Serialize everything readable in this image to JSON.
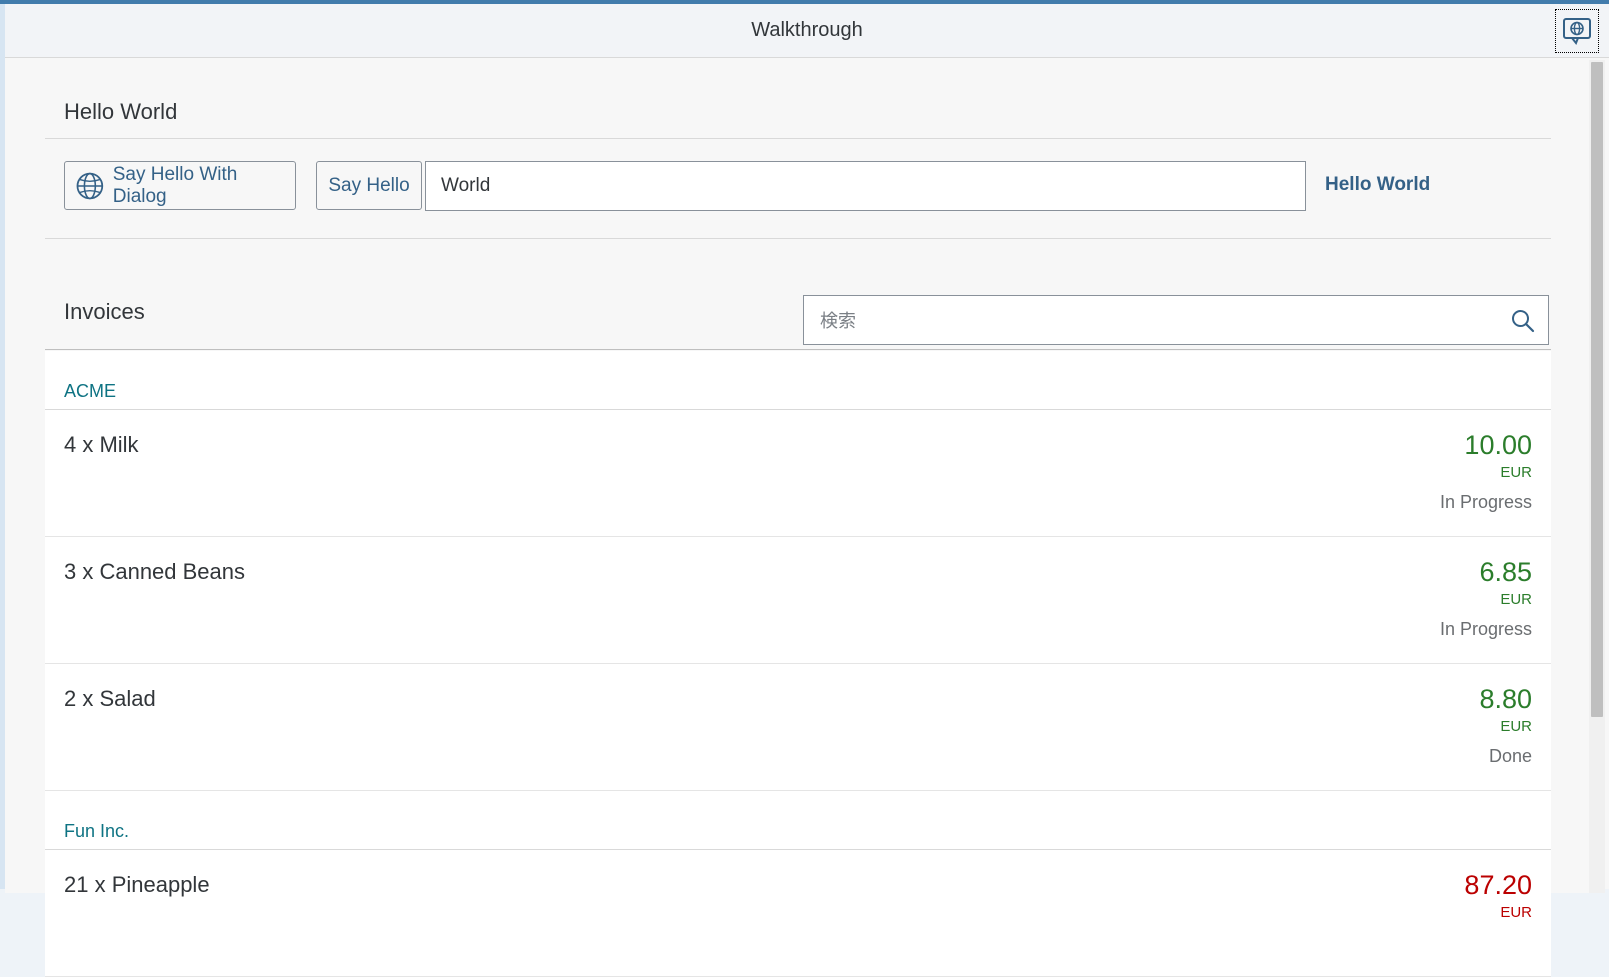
{
  "shell": {
    "title": "Walkthrough",
    "help_icon": "globe-chat-icon"
  },
  "panel": {
    "title": "Hello World",
    "dialog_button_label": "Say Hello With Dialog",
    "dialog_button_icon": "globe-icon",
    "hello_button_label": "Say Hello",
    "name_input_value": "World",
    "hello_text": "Hello World"
  },
  "invoices": {
    "title": "Invoices",
    "search_placeholder": "検索",
    "search_icon": "search-icon",
    "groups": [
      {
        "name": "ACME",
        "items": [
          {
            "title": "4 x Milk",
            "amount": "10.00",
            "currency": "EUR",
            "status": "In Progress",
            "state": "positive"
          },
          {
            "title": "3 x Canned Beans",
            "amount": "6.85",
            "currency": "EUR",
            "status": "In Progress",
            "state": "positive"
          },
          {
            "title": "2 x Salad",
            "amount": "8.80",
            "currency": "EUR",
            "status": "Done",
            "state": "positive"
          }
        ]
      },
      {
        "name": "Fun Inc.",
        "items": [
          {
            "title": "21 x Pineapple",
            "amount": "87.20",
            "currency": "EUR",
            "status": "",
            "state": "negative"
          }
        ]
      }
    ]
  },
  "colors": {
    "accent": "#427cac",
    "link": "#346187",
    "positive": "#2b7d2b",
    "negative": "#bb0000",
    "group_header": "#0e7383"
  }
}
